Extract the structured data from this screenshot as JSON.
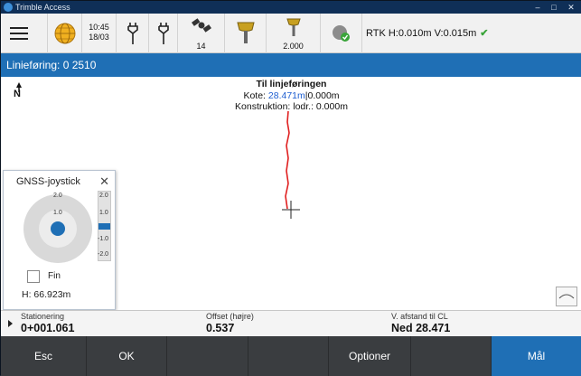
{
  "window": {
    "title": "Trimble Access"
  },
  "toolbar": {
    "time": "10:45",
    "date": "18/03",
    "satellites": "14",
    "antenna_height": "2.000",
    "rtk_status": "RTK H:0.010m V:0.015m"
  },
  "header": {
    "title": "Linieføring: 0 2510"
  },
  "map": {
    "north_label": "N",
    "info_title": "Til linjeføringen",
    "kote_label": "Kote:",
    "kote_value": "28.471m",
    "kote_offset": "|0.000m",
    "construction_label": "Konstruktion: lodr.: 0.000m"
  },
  "joystick": {
    "title": "GNSS-joystick",
    "ring_labels": [
      "2.0",
      "1.0"
    ],
    "scale_labels": [
      "2.0",
      "1.0",
      "-1.0",
      "-2.0"
    ],
    "fin_label": "Fin",
    "h_value": "H: 66.923m"
  },
  "status": {
    "station_label": "Stationering",
    "station_value": "0+001.061",
    "offset_label": "Offset (højre)",
    "offset_value": "0.537",
    "vdist_label": "V. afstand til CL",
    "vdist_value": "Ned 28.471"
  },
  "buttons": {
    "esc": "Esc",
    "ok": "OK",
    "options": "Optioner",
    "measure": "Mål"
  },
  "colors": {
    "accent_blue": "#1f6fb5",
    "line_red": "#e02020",
    "rtk_ok": "#3aa43a"
  }
}
